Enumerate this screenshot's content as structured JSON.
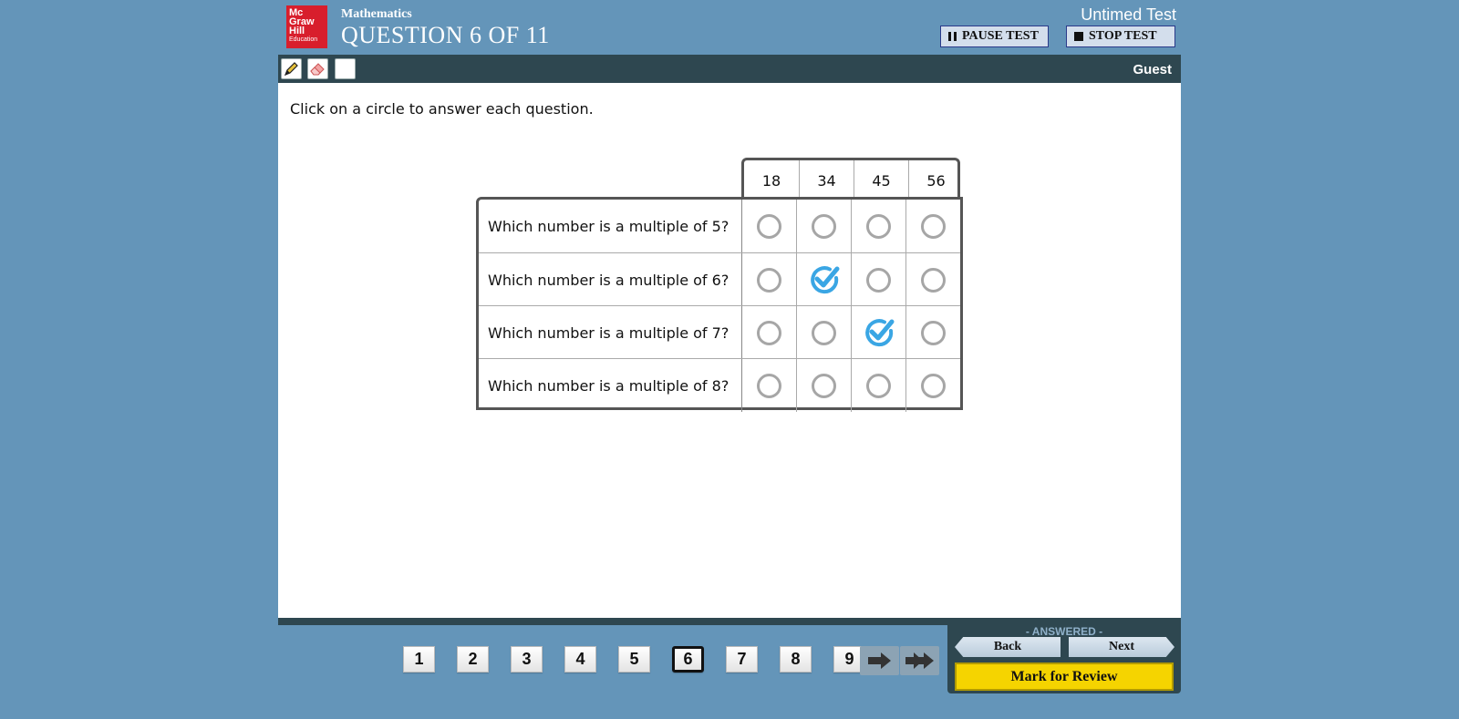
{
  "header": {
    "logo_lines": [
      "Mc",
      "Graw",
      "Hill",
      "Education"
    ],
    "subject": "Mathematics",
    "question_title": "QUESTION 6 OF 11",
    "test_mode": "Untimed Test",
    "pause_label": "PAUSE TEST",
    "stop_label": "STOP TEST"
  },
  "toolbar": {
    "tools": [
      "pencil-icon",
      "eraser-icon",
      "blank-tool"
    ],
    "user": "Guest"
  },
  "question": {
    "instructions": "Click on a circle to answer each question.",
    "columns": [
      "18",
      "34",
      "45",
      "56"
    ],
    "rows": [
      {
        "prompt": "Which number is a multiple of 5?",
        "selected": null
      },
      {
        "prompt": "Which number is a multiple of 6?",
        "selected": 1
      },
      {
        "prompt": "Which number is a multiple of 7?",
        "selected": 2
      },
      {
        "prompt": "Which number is a multiple of 8?",
        "selected": null
      }
    ],
    "check_color": "#3aa6e4"
  },
  "navigation": {
    "pages": [
      "1",
      "2",
      "3",
      "4",
      "5",
      "6",
      "7",
      "8",
      "9"
    ],
    "current_page": "6",
    "status": "- ANSWERED -",
    "back_label": "Back",
    "next_label": "Next",
    "mark_label": "Mark for Review"
  },
  "colors": {
    "background": "#6495b9",
    "toolbar": "#2e4750",
    "logo": "#d81e2c",
    "mark_button": "#f5d400"
  }
}
